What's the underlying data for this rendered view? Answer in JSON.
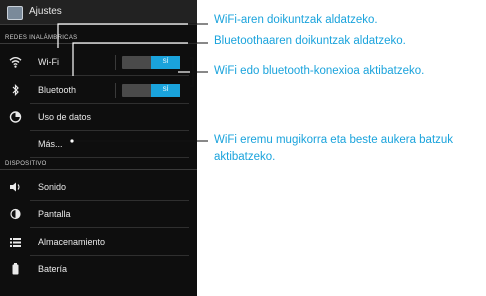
{
  "app": {
    "title": "Ajustes",
    "icon": "settings-app-icon"
  },
  "sections": {
    "wireless": "REDES INALÁMBRICAS",
    "device": "DISPOSITIVO"
  },
  "items": {
    "wifi": {
      "label": "Wi-Fi",
      "icon": "wifi-icon",
      "toggle": "SÍ"
    },
    "bluetooth": {
      "label": "Bluetooth",
      "icon": "bluetooth-icon",
      "toggle": "SÍ"
    },
    "data": {
      "label": "Uso de datos",
      "icon": "data-usage-icon"
    },
    "more": {
      "label": "Más..."
    },
    "sound": {
      "label": "Sonido",
      "icon": "speaker-icon"
    },
    "display": {
      "label": "Pantalla",
      "icon": "brightness-icon"
    },
    "storage": {
      "label": "Almacenamiento",
      "icon": "storage-icon"
    },
    "battery": {
      "label": "Batería",
      "icon": "battery-icon"
    }
  },
  "annotations": {
    "wifi_settings": "WiFi-aren doikuntzak aldatzeko.",
    "bt_settings": "Bluetoothaaren doikuntzak aldatzeko.",
    "toggle_help": "WiFi edo bluetooth-konexioa aktibatzeko.",
    "more_line1": "WiFi eremu mugikorra eta beste aukera batzuk",
    "more_line2": "aktibatzeko."
  },
  "colors": {
    "accent": "#1aa3dc",
    "panel": "#0e0e0e"
  }
}
